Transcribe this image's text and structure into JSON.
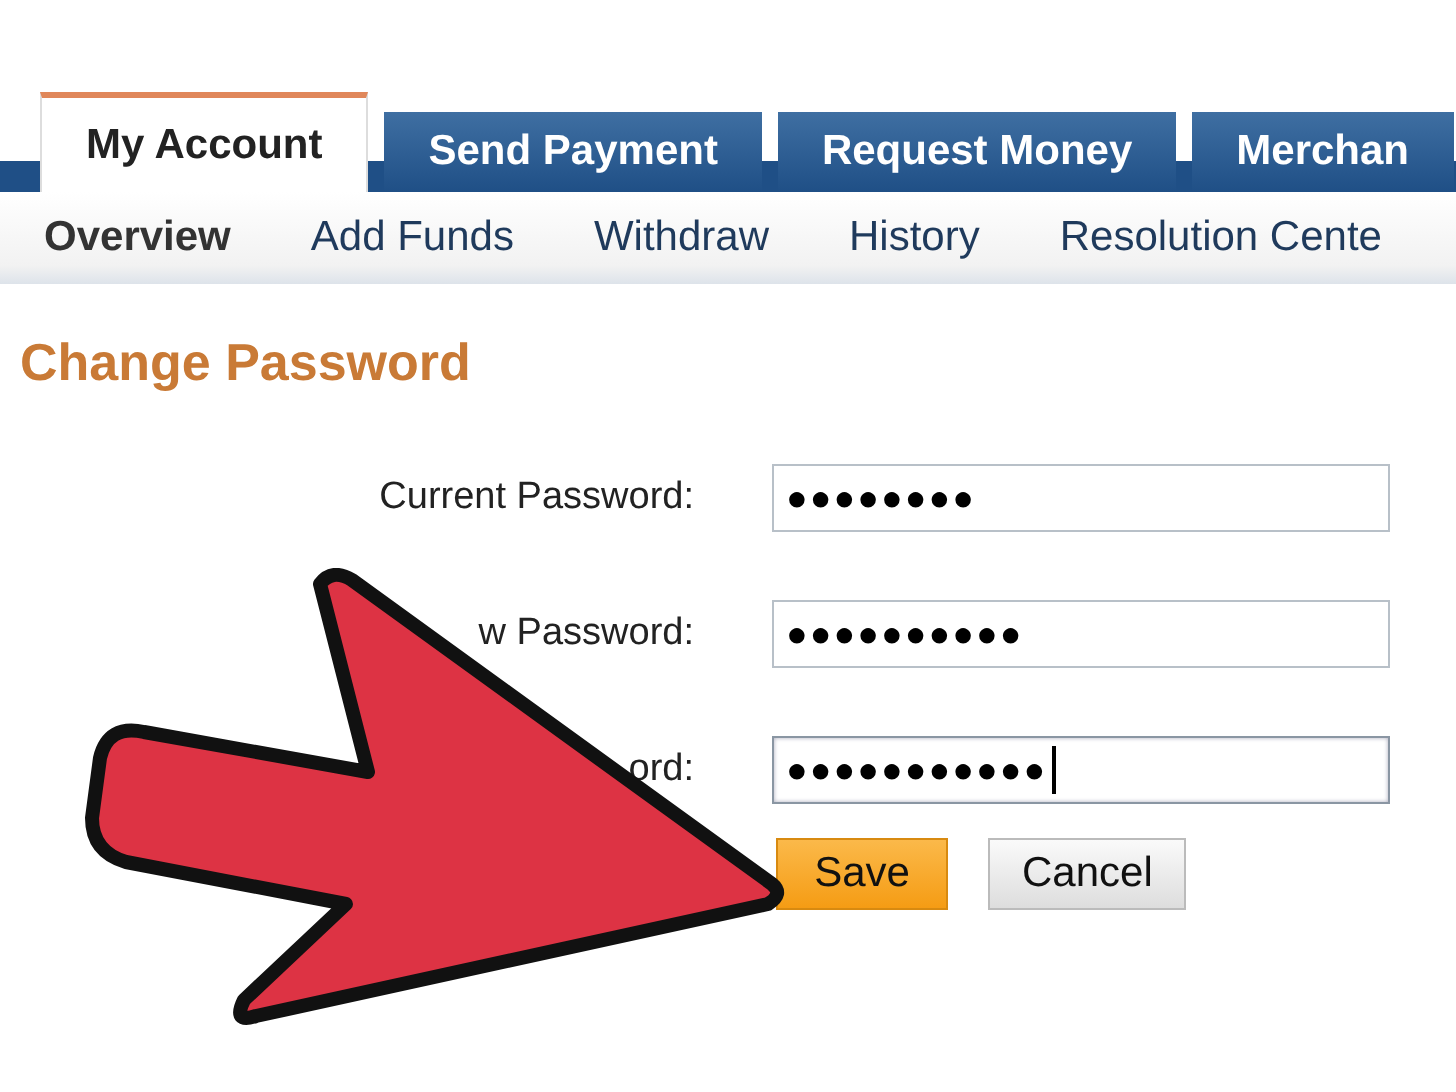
{
  "tabs": [
    {
      "label": "My Account",
      "selected": true
    },
    {
      "label": "Send Payment",
      "selected": false
    },
    {
      "label": "Request Money",
      "selected": false
    },
    {
      "label": "Merchan",
      "selected": false
    }
  ],
  "subnav": [
    {
      "label": "Overview",
      "selected": true
    },
    {
      "label": "Add Funds",
      "selected": false
    },
    {
      "label": "Withdraw",
      "selected": false
    },
    {
      "label": "History",
      "selected": false
    },
    {
      "label": "Resolution Cente",
      "selected": false
    }
  ],
  "heading": "Change Password",
  "fields": [
    {
      "label": "Current Password:",
      "value": "●●●●●●●●",
      "focused": false
    },
    {
      "label": "w Password:",
      "value": "●●●●●●●●●●",
      "focused": false
    },
    {
      "label": "ord:",
      "value": "●●●●●●●●●●●",
      "focused": true
    }
  ],
  "buttons": [
    {
      "label": "Save",
      "kind": "primary"
    },
    {
      "label": "Cancel",
      "kind": "secondary"
    }
  ]
}
